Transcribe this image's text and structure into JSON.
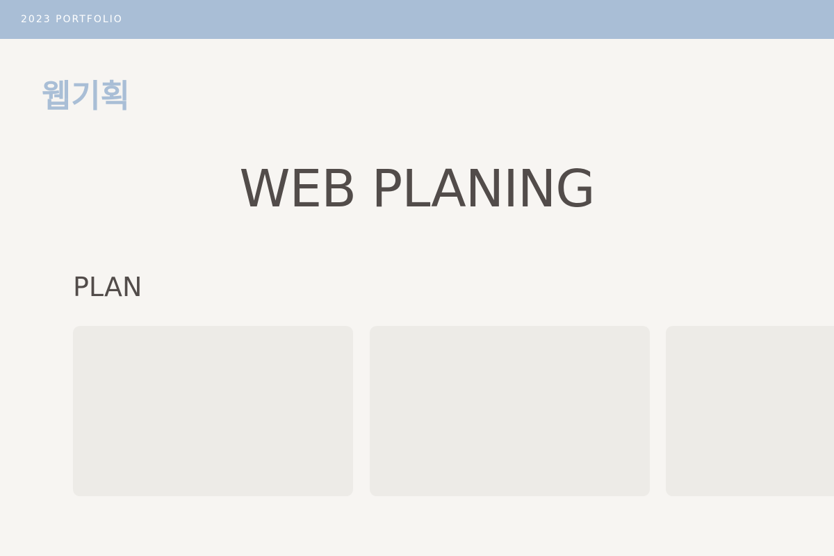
{
  "header": {
    "label": "2023 PORTFOLIO"
  },
  "page": {
    "category": "웹기획",
    "title": "WEB PLANING",
    "section_title": "PLAN"
  }
}
